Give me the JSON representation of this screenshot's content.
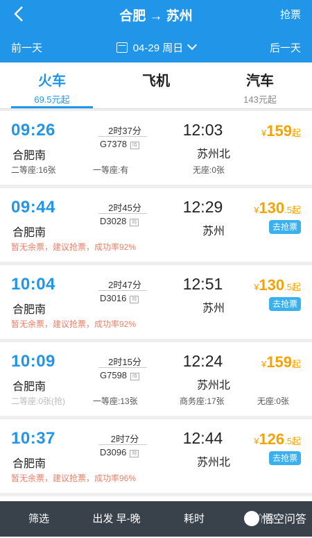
{
  "header": {
    "title": "合肥 → 苏州",
    "grab_label": "抢票",
    "prev_day": "前一天",
    "next_day": "后一天",
    "date": "04-29 周日"
  },
  "tabs": [
    {
      "label": "火车",
      "sub": "69.5元起",
      "active": true
    },
    {
      "label": "飞机",
      "sub": "",
      "active": false
    },
    {
      "label": "汽车",
      "sub": "143元起",
      "active": false
    }
  ],
  "trains": [
    {
      "dep_time": "09:26",
      "dep_station": "合肥南",
      "duration": "2时37分",
      "train_no": "G7378",
      "arr_time": "12:03",
      "arr_station": "苏州北",
      "price_int": "159",
      "price_dec": "",
      "price_suffix": "起",
      "button": "",
      "note": "",
      "seats": [
        "二等座:16张",
        "一等座:有",
        "无座:0张"
      ]
    },
    {
      "dep_time": "09:44",
      "dep_station": "合肥南",
      "duration": "2时45分",
      "train_no": "D3028",
      "arr_time": "12:29",
      "arr_station": "苏州",
      "price_int": "130",
      "price_dec": ".5",
      "price_suffix": "起",
      "button": "去抢票",
      "note": "暂无余票，建议抢票，成功率92%",
      "seats": []
    },
    {
      "dep_time": "10:04",
      "dep_station": "合肥南",
      "duration": "2时47分",
      "train_no": "D3016",
      "arr_time": "12:51",
      "arr_station": "苏州",
      "price_int": "130",
      "price_dec": ".5",
      "price_suffix": "起",
      "button": "去抢票",
      "note": "暂无余票，建议抢票，成功率92%",
      "seats": []
    },
    {
      "dep_time": "10:09",
      "dep_station": "合肥南",
      "duration": "2时15分",
      "train_no": "G7598",
      "arr_time": "12:24",
      "arr_station": "苏州北",
      "price_int": "159",
      "price_dec": "",
      "price_suffix": "起",
      "button": "",
      "note": "",
      "seats": [
        "二等座:0张(抢)",
        "一等座:13张",
        "商务座:17张",
        "无座:0张"
      ]
    },
    {
      "dep_time": "10:37",
      "dep_station": "合肥南",
      "duration": "2时7分",
      "train_no": "D3096",
      "arr_time": "12:44",
      "arr_station": "苏州北",
      "price_int": "126",
      "price_dec": ".5",
      "price_suffix": "起",
      "button": "去抢票",
      "note": "暂无余票，建议抢票，成功率96%",
      "seats": []
    }
  ],
  "bottom_bar": {
    "filter": "筛选",
    "depart": "出发 早-晚",
    "duration": "耗时",
    "price": "价格",
    "watermark": "悟空问答"
  },
  "colors": {
    "accent": "#2196e8",
    "price": "#f4a300",
    "note": "#e8826a"
  }
}
